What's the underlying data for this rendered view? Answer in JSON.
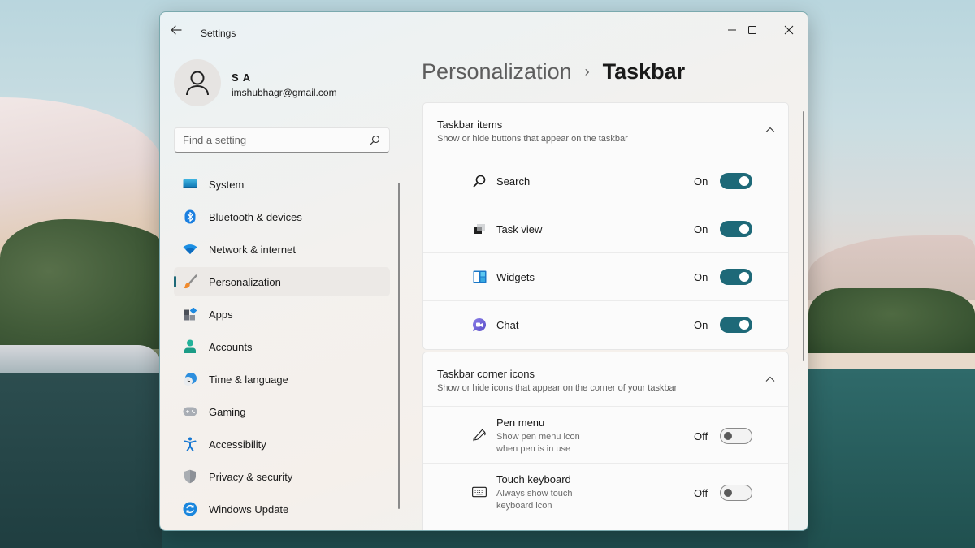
{
  "window": {
    "app_title": "Settings",
    "controls": {
      "minimize": "minimize",
      "maximize": "maximize",
      "close": "close"
    }
  },
  "user": {
    "name": "S A",
    "email": "imshubhagr@gmail.com",
    "avatar_icon": "person-icon"
  },
  "search": {
    "placeholder": "Find a setting",
    "value": ""
  },
  "sidebar": {
    "items": [
      {
        "label": "System",
        "icon": "system-icon",
        "active": false
      },
      {
        "label": "Bluetooth & devices",
        "icon": "bluetooth-icon",
        "active": false
      },
      {
        "label": "Network & internet",
        "icon": "wifi-icon",
        "active": false
      },
      {
        "label": "Personalization",
        "icon": "brush-icon",
        "active": true
      },
      {
        "label": "Apps",
        "icon": "apps-icon",
        "active": false
      },
      {
        "label": "Accounts",
        "icon": "account-icon",
        "active": false
      },
      {
        "label": "Time & language",
        "icon": "globe-clock-icon",
        "active": false
      },
      {
        "label": "Gaming",
        "icon": "gamepad-icon",
        "active": false
      },
      {
        "label": "Accessibility",
        "icon": "accessibility-icon",
        "active": false
      },
      {
        "label": "Privacy & security",
        "icon": "shield-icon",
        "active": false
      },
      {
        "label": "Windows Update",
        "icon": "update-icon",
        "active": false
      }
    ]
  },
  "breadcrumb": {
    "parent": "Personalization",
    "separator": "›",
    "current": "Taskbar"
  },
  "sections": [
    {
      "title": "Taskbar items",
      "subtitle": "Show or hide buttons that appear on the taskbar",
      "expanded": true,
      "items": [
        {
          "label": "Search",
          "icon": "search-icon",
          "state": "On",
          "on": true
        },
        {
          "label": "Task view",
          "icon": "task-view-icon",
          "state": "On",
          "on": true
        },
        {
          "label": "Widgets",
          "icon": "widgets-icon",
          "state": "On",
          "on": true
        },
        {
          "label": "Chat",
          "icon": "chat-icon",
          "state": "On",
          "on": true
        }
      ]
    },
    {
      "title": "Taskbar corner icons",
      "subtitle": "Show or hide icons that appear on the corner of your taskbar",
      "expanded": true,
      "items": [
        {
          "label": "Pen menu",
          "description": "Show pen menu icon when pen is in use",
          "icon": "pen-icon",
          "state": "Off",
          "on": false
        },
        {
          "label": "Touch keyboard",
          "description": "Always show touch keyboard icon",
          "icon": "keyboard-icon",
          "state": "Off",
          "on": false
        }
      ]
    }
  ],
  "colors": {
    "accent": "#1e6978",
    "toggle_off_knob": "#5a5a5a"
  }
}
